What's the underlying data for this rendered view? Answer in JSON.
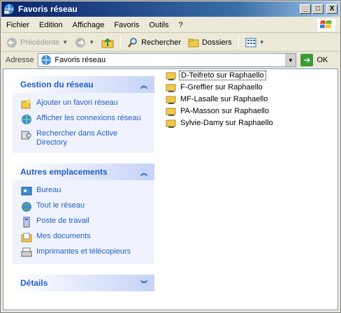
{
  "window": {
    "title": "Favoris réseau"
  },
  "titlebar_buttons": {
    "minimize": "_",
    "maximize": "□",
    "close": "X"
  },
  "menu": [
    {
      "label": "Fichier"
    },
    {
      "label": "Edition"
    },
    {
      "label": "Affichage"
    },
    {
      "label": "Favoris"
    },
    {
      "label": "Outils"
    },
    {
      "label": "?"
    }
  ],
  "toolbar": {
    "back_label": "Précédente",
    "search_label": "Rechercher",
    "folders_label": "Dossiers"
  },
  "address": {
    "label": "Adresse",
    "value": "Favoris réseau",
    "go_label": "OK"
  },
  "panels": {
    "network_tasks": {
      "title": "Gestion du réseau",
      "links": [
        {
          "label": "Ajouter un favori réseau",
          "icon": "add-network-place-icon"
        },
        {
          "label": "Afficher les connexions réseau",
          "icon": "network-connections-icon"
        },
        {
          "label": "Rechercher dans Active Directory",
          "icon": "search-directory-icon"
        }
      ]
    },
    "other_places": {
      "title": "Autres emplacements",
      "links": [
        {
          "label": "Bureau",
          "icon": "desktop-icon"
        },
        {
          "label": "Tout le réseau",
          "icon": "entire-network-icon"
        },
        {
          "label": "Poste de travail",
          "icon": "my-computer-icon"
        },
        {
          "label": "Mes documents",
          "icon": "my-documents-icon"
        },
        {
          "label": "Imprimantes et télécopieurs",
          "icon": "printers-icon"
        }
      ]
    },
    "details": {
      "title": "Détails"
    }
  },
  "network_places": [
    {
      "label": "D-Teifreto sur Raphaello"
    },
    {
      "label": "F-Greffier sur Raphaello"
    },
    {
      "label": "MF-Lasalle sur Raphaello"
    },
    {
      "label": "PA-Masson sur Raphaello"
    },
    {
      "label": "Sylvie-Damy sur Raphaello"
    }
  ],
  "colors": {
    "accent": "#215dc6",
    "titlebar": "#0a246a",
    "panel_bg": "#f0f3fd"
  }
}
